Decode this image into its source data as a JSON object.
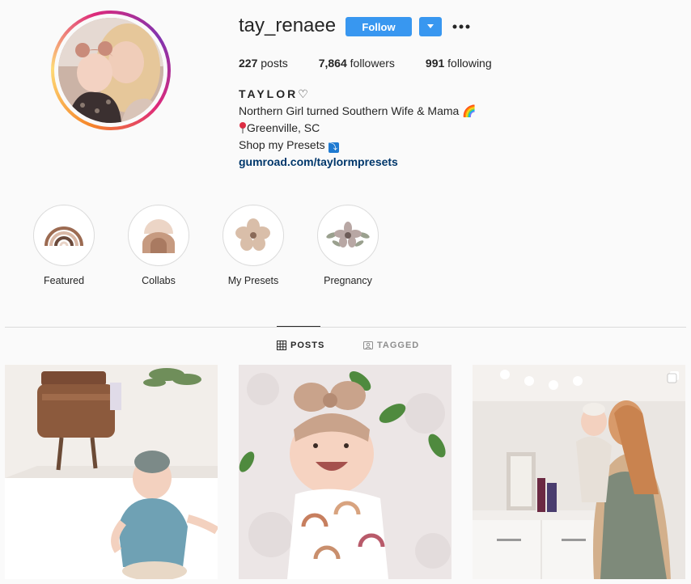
{
  "profile": {
    "username": "tay_renaee",
    "follow_label": "Follow",
    "posts_count": "227",
    "posts_label": "posts",
    "followers_count": "7,864",
    "followers_label": "followers",
    "following_count": "991",
    "following_label": "following"
  },
  "bio": {
    "name": "TAYLOR♡",
    "line1": "Northern Girl turned Southern Wife & Mama 🌈",
    "location": "Greenville, SC",
    "line3": "Shop my Presets",
    "link": "gumroad.com/taylormpresets"
  },
  "highlights": [
    {
      "label": "Featured",
      "icon": "rainbow-icon"
    },
    {
      "label": "Collabs",
      "icon": "sun-arch-icon"
    },
    {
      "label": "My Presets",
      "icon": "flower-icon"
    },
    {
      "label": "Pregnancy",
      "icon": "floral-wreath-icon"
    }
  ],
  "tabs": {
    "posts_label": "POSTS",
    "tagged_label": "TAGGED",
    "active": "POSTS"
  },
  "posts": [
    {
      "description": "baby in denim top sitting on white shelf below a brown backpack",
      "icon": null
    },
    {
      "description": "smiling baby with bow headband and rainbow onesie",
      "icon": null
    },
    {
      "description": "mom kissing baby in bathroom",
      "icon": "multiple-photos-icon"
    }
  ],
  "colors": {
    "accent": "#3897f0",
    "link": "#00376b",
    "text": "#262626",
    "muted": "#8e8e8e",
    "background": "#fafafa",
    "border": "#dbdbdb"
  }
}
